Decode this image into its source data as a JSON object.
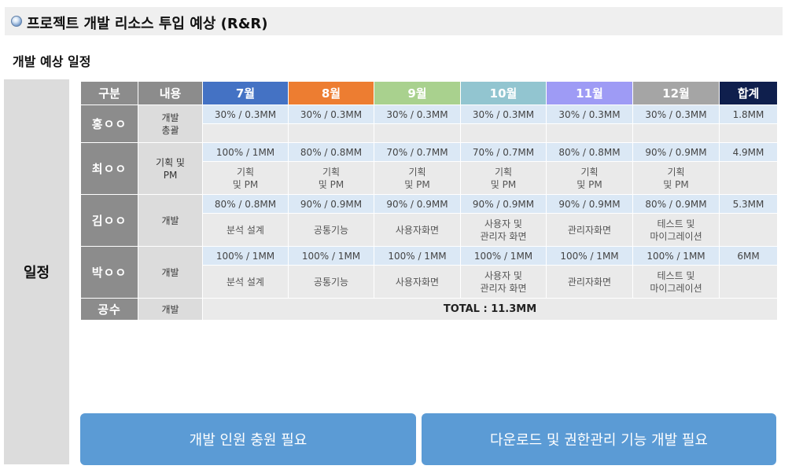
{
  "page": {
    "title": "프로젝트 개발 리소스 투입 예상 (R&R)",
    "section_title": "개발 예상 일정",
    "side_label": "일정"
  },
  "table": {
    "headers": [
      "구분",
      "내용",
      "7월",
      "8월",
      "9월",
      "10월",
      "11월",
      "12월",
      "합계"
    ],
    "header_colors": [
      "#8c8c8c",
      "#8c8c8c",
      "#4472c4",
      "#ed7d31",
      "#a9d18e",
      "#92c5d0",
      "#9e9bf5",
      "#a5a5a5",
      "#0f1f4d"
    ],
    "rows": [
      {
        "name": "홍ㅇㅇ",
        "task": "개발\n총괄",
        "months": [
          "30% / 0.3MM",
          "30% / 0.3MM",
          "30% / 0.3MM",
          "30% / 0.3MM",
          "30% / 0.3MM",
          "30% / 0.3MM"
        ],
        "desc": [
          "",
          "",
          "",
          "",
          "",
          ""
        ],
        "total": "1.8MM"
      },
      {
        "name": "최ㅇㅇ",
        "task": "기획 및\nPM",
        "months": [
          "100% / 1MM",
          "80% / 0.8MM",
          "70% / 0.7MM",
          "70% / 0.7MM",
          "80% / 0.8MM",
          "90% / 0.9MM"
        ],
        "desc": [
          "기획\n및 PM",
          "기획\n및 PM",
          "기획\n및 PM",
          "기획\n및 PM",
          "기획\n및 PM",
          "기획\n및 PM"
        ],
        "total": "4.9MM"
      },
      {
        "name": "김ㅇㅇ",
        "task": "개발",
        "months": [
          "80% / 0.8MM",
          "90% / 0.9MM",
          "90% / 0.9MM",
          "90% / 0.9MM",
          "90% / 0.9MM",
          "80% / 0.9MM"
        ],
        "desc": [
          "분석 설계",
          "공통기능",
          "사용자화면",
          "사용자 및\n관리자 화면",
          "관리자화면",
          "테스트 및\n마이그레이션"
        ],
        "total": "5.3MM"
      },
      {
        "name": "박ㅇㅇ",
        "task": "개발",
        "months": [
          "100% / 1MM",
          "100% / 1MM",
          "100% / 1MM",
          "100% / 1MM",
          "100% / 1MM",
          "100% / 1MM"
        ],
        "desc": [
          "분석 설계",
          "공통기능",
          "사용자화면",
          "사용자 및\n관리자 화면",
          "관리자화면",
          "테스트 및\n마이그레이션"
        ],
        "total": "6MM"
      }
    ],
    "footer": {
      "label": "공수",
      "task": "개발",
      "total": "TOTAL : 11.3MM"
    }
  },
  "buttons": {
    "left": "개발 인원 충원 필요",
    "right": "다운로드 및 권한관리 기능 개발 필요"
  }
}
